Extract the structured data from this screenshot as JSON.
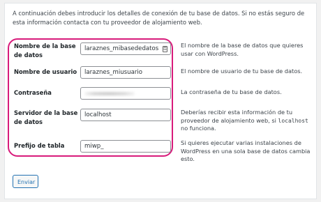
{
  "intro": "A continuación debes introducir los detalles de conexión de tu base de datos. Si no estás seguro de esta información contacta con tu proveedor de alojamiento web.",
  "fields": {
    "dbname": {
      "label": "Nombre de la base de datos",
      "value": "laraznes_mibasededatos",
      "desc": "El nombre de la base de datos que quieres usar con WordPress."
    },
    "uname": {
      "label": "Nombre de usuario",
      "value": "laraznes_miusuario",
      "desc": "El nombre de usuario de tu base de datos."
    },
    "pwd": {
      "label": "Contraseña",
      "value": "",
      "desc": "La contraseña de tu base de datos."
    },
    "dbhost": {
      "label": "Servidor de la base de datos",
      "value": "localhost",
      "desc_before": "Deberías recibir esta información de tu proveedor de alojamiento web, si ",
      "desc_code": "localhost",
      "desc_after": " no funciona."
    },
    "prefix": {
      "label": "Prefijo de tabla",
      "value": "miwp_",
      "desc": "Si quieres ejecutar varias instalaciones de WordPress en una sola base de datos cambia esto."
    }
  },
  "submit_label": "Enviar",
  "colors": {
    "highlight_border": "#d81b7b",
    "button_accent": "#2271b1"
  },
  "icons": {
    "dbname_field_icon": "key-icon"
  }
}
